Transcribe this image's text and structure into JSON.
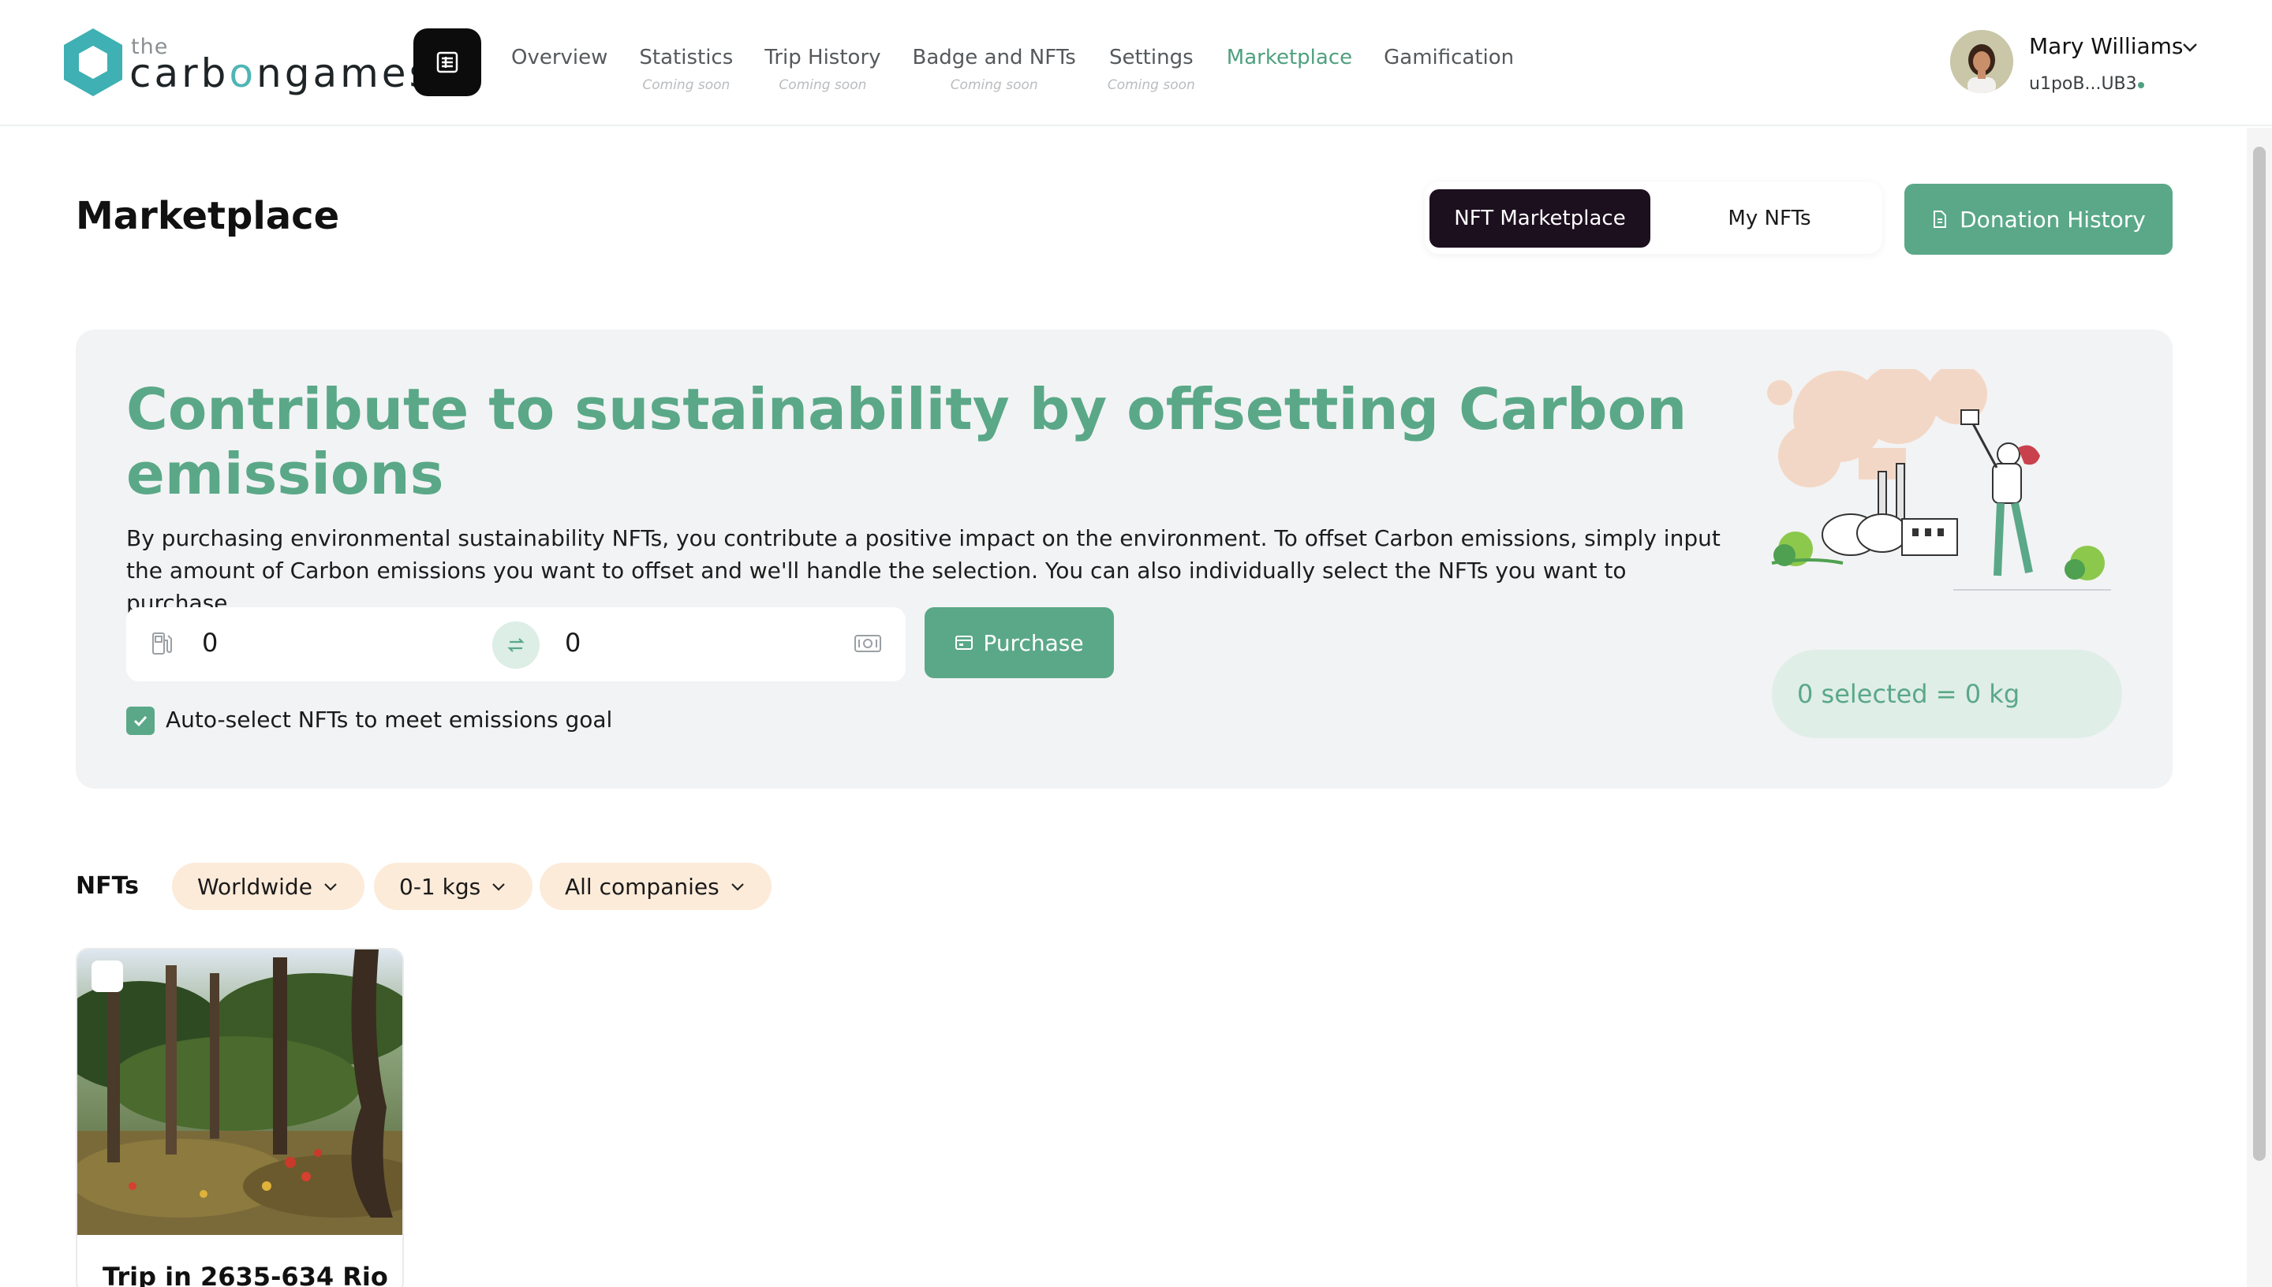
{
  "header": {
    "logo": {
      "the": "the",
      "word_before": "carb",
      "word_o": "o",
      "word_after": "ngames"
    },
    "menu_icon": "list-icon",
    "nav": [
      {
        "label": "Overview",
        "sub": "",
        "active": false
      },
      {
        "label": "Statistics",
        "sub": "Coming soon",
        "active": false
      },
      {
        "label": "Trip History",
        "sub": "Coming soon",
        "active": false
      },
      {
        "label": "Badge and NFTs",
        "sub": "Coming soon",
        "active": false
      },
      {
        "label": "Settings",
        "sub": "Coming soon",
        "active": false
      },
      {
        "label": "Marketplace",
        "sub": "",
        "active": true
      },
      {
        "label": "Gamification",
        "sub": "",
        "active": false
      }
    ],
    "user": {
      "name": "Mary Williams",
      "address": "u1poB...UB3"
    }
  },
  "page": {
    "title": "Marketplace",
    "tabs": {
      "active": "NFT Marketplace",
      "other": "My NFTs"
    },
    "donation_button": "Donation History"
  },
  "hero": {
    "title": "Contribute to sustainability by offsetting Carbon emissions",
    "description": "By purchasing environmental sustainability NFTs, you contribute a positive impact on the environment. To offset Carbon emissions, simply input the amount of Carbon emissions you want to offset and we'll handle the selection. You can also individually select the NFTs you want to purchase.",
    "emissions_value": "0",
    "cost_value": "0",
    "purchase_button": "Purchase",
    "auto_select_label": "Auto-select NFTs to meet emissions goal",
    "auto_select_checked": true,
    "selected_summary": "0 selected = 0 kg"
  },
  "nfts": {
    "label": "NFTs",
    "filters": [
      "Worldwide",
      "0-1 kgs",
      "All companies"
    ],
    "cards": [
      {
        "title": "Trip in 2635-634 Rio"
      }
    ]
  },
  "colors": {
    "accent_green": "#5aa888",
    "dark": "#1c0f1e",
    "filter_bg": "#fcebd9",
    "hero_bg": "#f2f3f4"
  }
}
